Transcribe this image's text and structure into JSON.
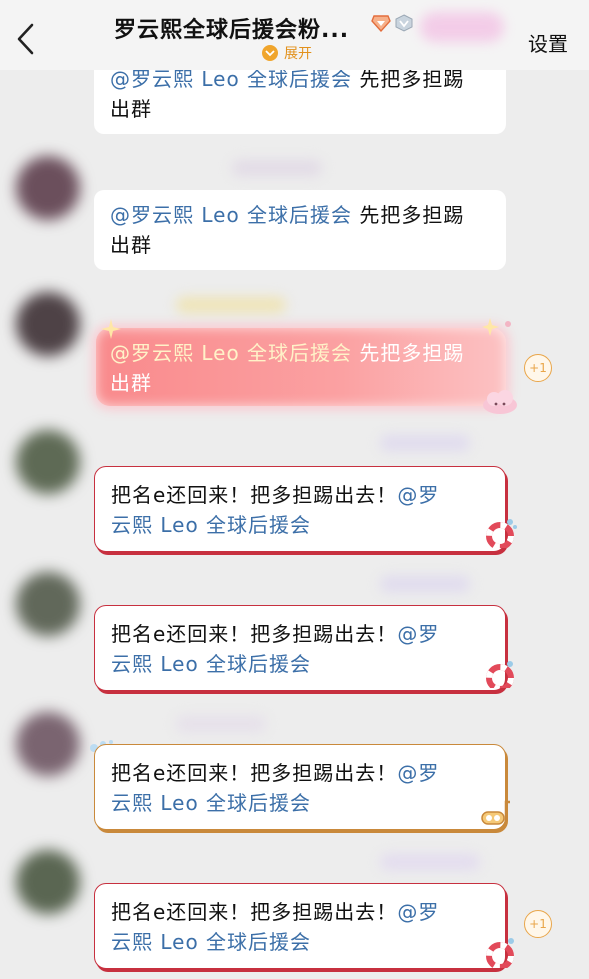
{
  "header": {
    "title": "罗云熙全球后援会粉...",
    "expand_label": "展开",
    "settings_label": "设置"
  },
  "messages": [
    {
      "mention": "@罗云熙 Leo 全球后援会",
      "text": " 先把多担踢",
      "text2": "出群"
    },
    {
      "mention": "@罗云熙 Leo 全球后援会",
      "text": " 先把多担踢",
      "text2": "出群"
    },
    {
      "mention": "@罗云熙 Leo 全球后援会",
      "text": " 先把多担踢",
      "text2": "出群",
      "reaction": "+1"
    },
    {
      "text": "把名e还回来！把多担踢出去！",
      "mention": "@罗",
      "mention2": "云熙 Leo 全球后援会"
    },
    {
      "text": "把名e还回来！把多担踢出去！",
      "mention": "@罗",
      "mention2": "云熙 Leo 全球后援会"
    },
    {
      "text": "把名e还回来！把多担踢出去！",
      "mention": "@罗",
      "mention2": "云熙 Leo 全球后援会"
    },
    {
      "text": "把名e还回来！把多担踢出去！",
      "mention": "@罗",
      "mention2": "云熙 Leo 全球后援会",
      "reaction": "+1"
    }
  ],
  "colors": {
    "mention": "#3c6fa8",
    "expand": "#e2911b",
    "bubble_border_red": "#c7303f",
    "bubble_border_gold": "#c9893b"
  },
  "icons": [
    "back-chevron-icon",
    "diamond-badge-icon",
    "verified-badge-icon",
    "expand-chevron-icon",
    "lifebuoy-sticker-icon",
    "cloud-sticker-icon",
    "snorkel-sticker-icon"
  ]
}
